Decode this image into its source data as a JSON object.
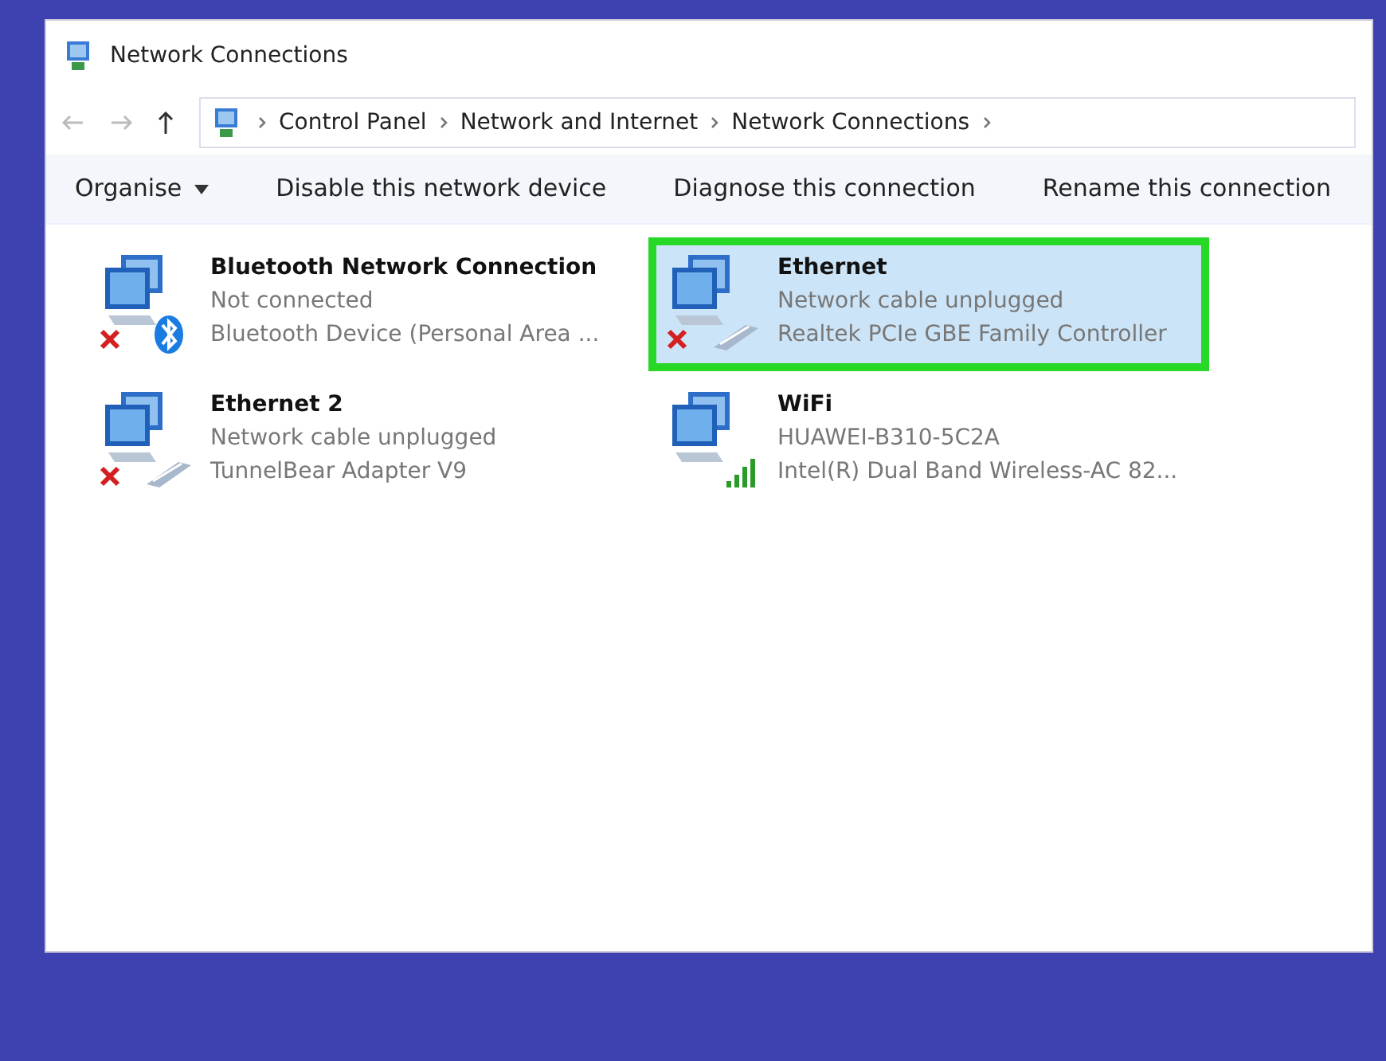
{
  "window": {
    "title": "Network Connections"
  },
  "address_bar": {
    "crumbs": [
      "Control Panel",
      "Network and Internet",
      "Network Connections"
    ]
  },
  "toolbar": [
    {
      "label": "Organise",
      "has_menu": true
    },
    {
      "label": "Disable this network device",
      "has_menu": false
    },
    {
      "label": "Diagnose this connection",
      "has_menu": false
    },
    {
      "label": "Rename this connection",
      "has_menu": false
    }
  ],
  "connections": [
    {
      "name": "Bluetooth Network Connection",
      "status": "Not connected",
      "device": "Bluetooth Device (Personal Area ...",
      "kind": "bluetooth",
      "disconnected": true,
      "selected": false
    },
    {
      "name": "Ethernet",
      "status": "Network cable unplugged",
      "device": "Realtek PCIe GBE Family Controller",
      "kind": "ethernet",
      "disconnected": true,
      "selected": true
    },
    {
      "name": "Ethernet 2",
      "status": "Network cable unplugged",
      "device": "TunnelBear Adapter V9",
      "kind": "ethernet",
      "disconnected": true,
      "selected": false
    },
    {
      "name": "WiFi",
      "status": "HUAWEI-B310-5C2A",
      "device": "Intel(R) Dual Band Wireless-AC 82...",
      "kind": "wifi",
      "disconnected": false,
      "selected": false
    }
  ]
}
